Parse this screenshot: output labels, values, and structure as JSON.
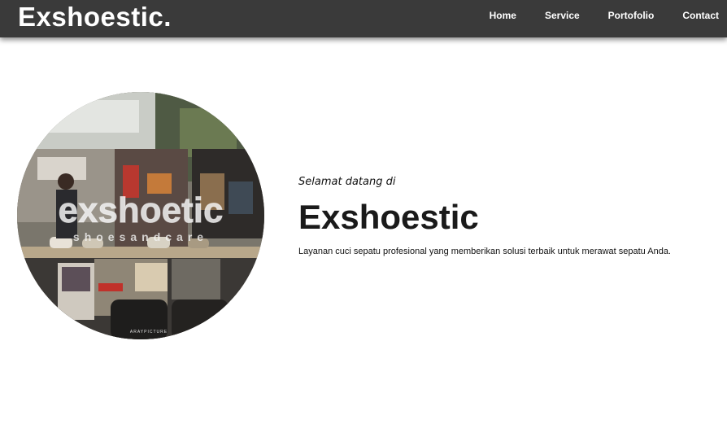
{
  "navbar": {
    "brand": "Exshoestic.",
    "links": [
      "Home",
      "Service",
      "Portofolio",
      "Contact"
    ]
  },
  "hero": {
    "image": {
      "logo_text": "exshoetic",
      "logo_subtext": "shoesandcare",
      "watermark": "ARAYPICTURE"
    },
    "welcome": "Selamat datang di",
    "title": "Exshoestic",
    "description": "Layanan cuci sepatu profesional yang memberikan solusi terbaik untuk merawat sepatu Anda."
  },
  "colors": {
    "navbar_bg": "#3a3a3a",
    "text_dark": "#1a1a1a",
    "background": "#ffffff"
  }
}
